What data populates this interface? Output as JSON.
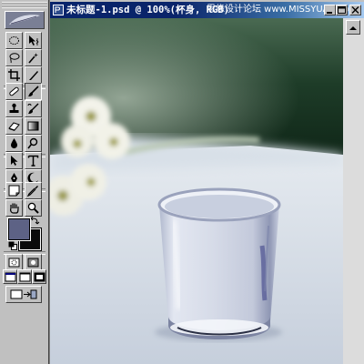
{
  "document_window": {
    "title": "未标题-1.psd @ 100%(杯身, RGB)",
    "watermark": "思缘设计论坛 www.MISSYUAN.com"
  },
  "toolbox": {
    "tools": [
      {
        "name": "marquee-tool",
        "icon": "dotted-ellipse"
      },
      {
        "name": "move-tool",
        "icon": "arrow-cross"
      },
      {
        "name": "lasso-tool",
        "icon": "lasso"
      },
      {
        "name": "magic-wand-tool",
        "icon": "magic-wand"
      },
      {
        "name": "crop-tool",
        "icon": "crop"
      },
      {
        "name": "slice-tool",
        "icon": "knife"
      },
      {
        "name": "healing-brush-tool",
        "icon": "bandage"
      },
      {
        "name": "brush-tool",
        "icon": "brush"
      },
      {
        "name": "clone-stamp-tool",
        "icon": "stamp"
      },
      {
        "name": "history-brush-tool",
        "icon": "history-brush"
      },
      {
        "name": "eraser-tool",
        "icon": "eraser"
      },
      {
        "name": "gradient-tool",
        "icon": "gradient"
      },
      {
        "name": "blur-tool",
        "icon": "drop"
      },
      {
        "name": "dodge-tool",
        "icon": "dodge"
      },
      {
        "name": "path-selection-tool",
        "icon": "arrow"
      },
      {
        "name": "type-tool",
        "icon": "T"
      },
      {
        "name": "pen-tool",
        "icon": "pen"
      },
      {
        "name": "shape-tool",
        "icon": "custom-shape"
      },
      {
        "name": "notes-tool",
        "icon": "note"
      },
      {
        "name": "eyedropper-tool",
        "icon": "eyedropper"
      },
      {
        "name": "hand-tool",
        "icon": "hand"
      },
      {
        "name": "zoom-tool",
        "icon": "magnifier"
      }
    ],
    "active_tool": "brush-tool",
    "foreground_color": "#5d6285",
    "background_color": "#0a0a0a"
  }
}
